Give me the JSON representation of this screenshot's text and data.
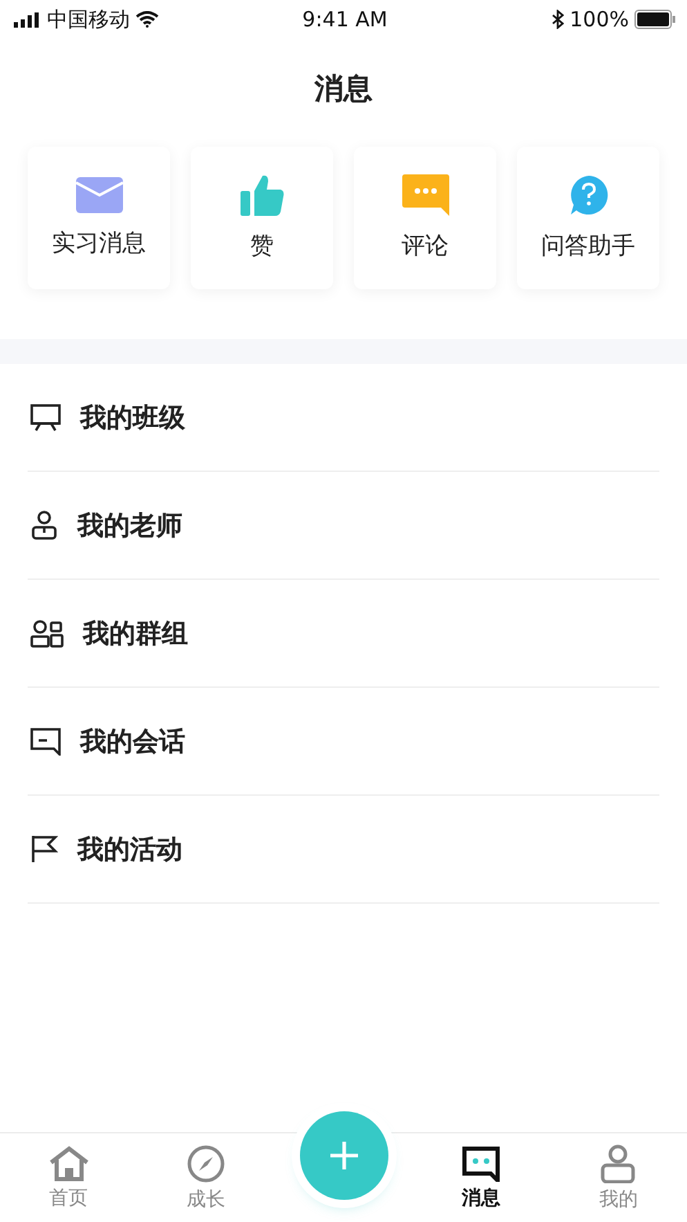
{
  "status_bar": {
    "carrier": "中国移动",
    "time": "9:41 AM",
    "battery": "100%"
  },
  "title": "消息",
  "shortcuts": [
    {
      "label": "实习消息"
    },
    {
      "label": "赞"
    },
    {
      "label": "评论"
    },
    {
      "label": "问答助手"
    }
  ],
  "list": [
    {
      "label": "我的班级"
    },
    {
      "label": "我的老师"
    },
    {
      "label": "我的群组"
    },
    {
      "label": "我的会话"
    },
    {
      "label": "我的活动"
    }
  ],
  "tab_bar": [
    {
      "label": "首页",
      "selected": false
    },
    {
      "label": "成长",
      "selected": false
    },
    {
      "label": "消息",
      "selected": true
    },
    {
      "label": "我的",
      "selected": false
    }
  ]
}
